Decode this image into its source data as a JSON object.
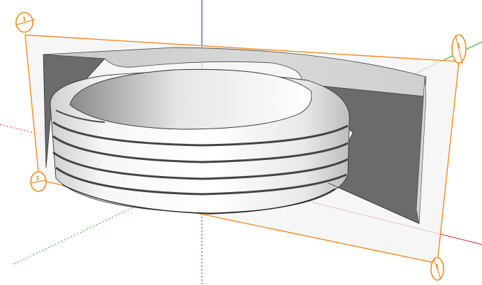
{
  "viewport": {
    "background": "#ffffff",
    "section_plane_color": "#f58a1f",
    "section_fill_color": "#6b6b6b",
    "axis_colors": {
      "red": "#d42020",
      "green": "#22a022",
      "blue": "#2020d0"
    },
    "section_grips": [
      {
        "name": "section-grip-top-left",
        "label": "1"
      },
      {
        "name": "section-grip-right-top",
        "label": "1"
      },
      {
        "name": "section-grip-left-mid",
        "label": "1"
      },
      {
        "name": "section-grip-bottom-right",
        "label": "1"
      }
    ]
  }
}
